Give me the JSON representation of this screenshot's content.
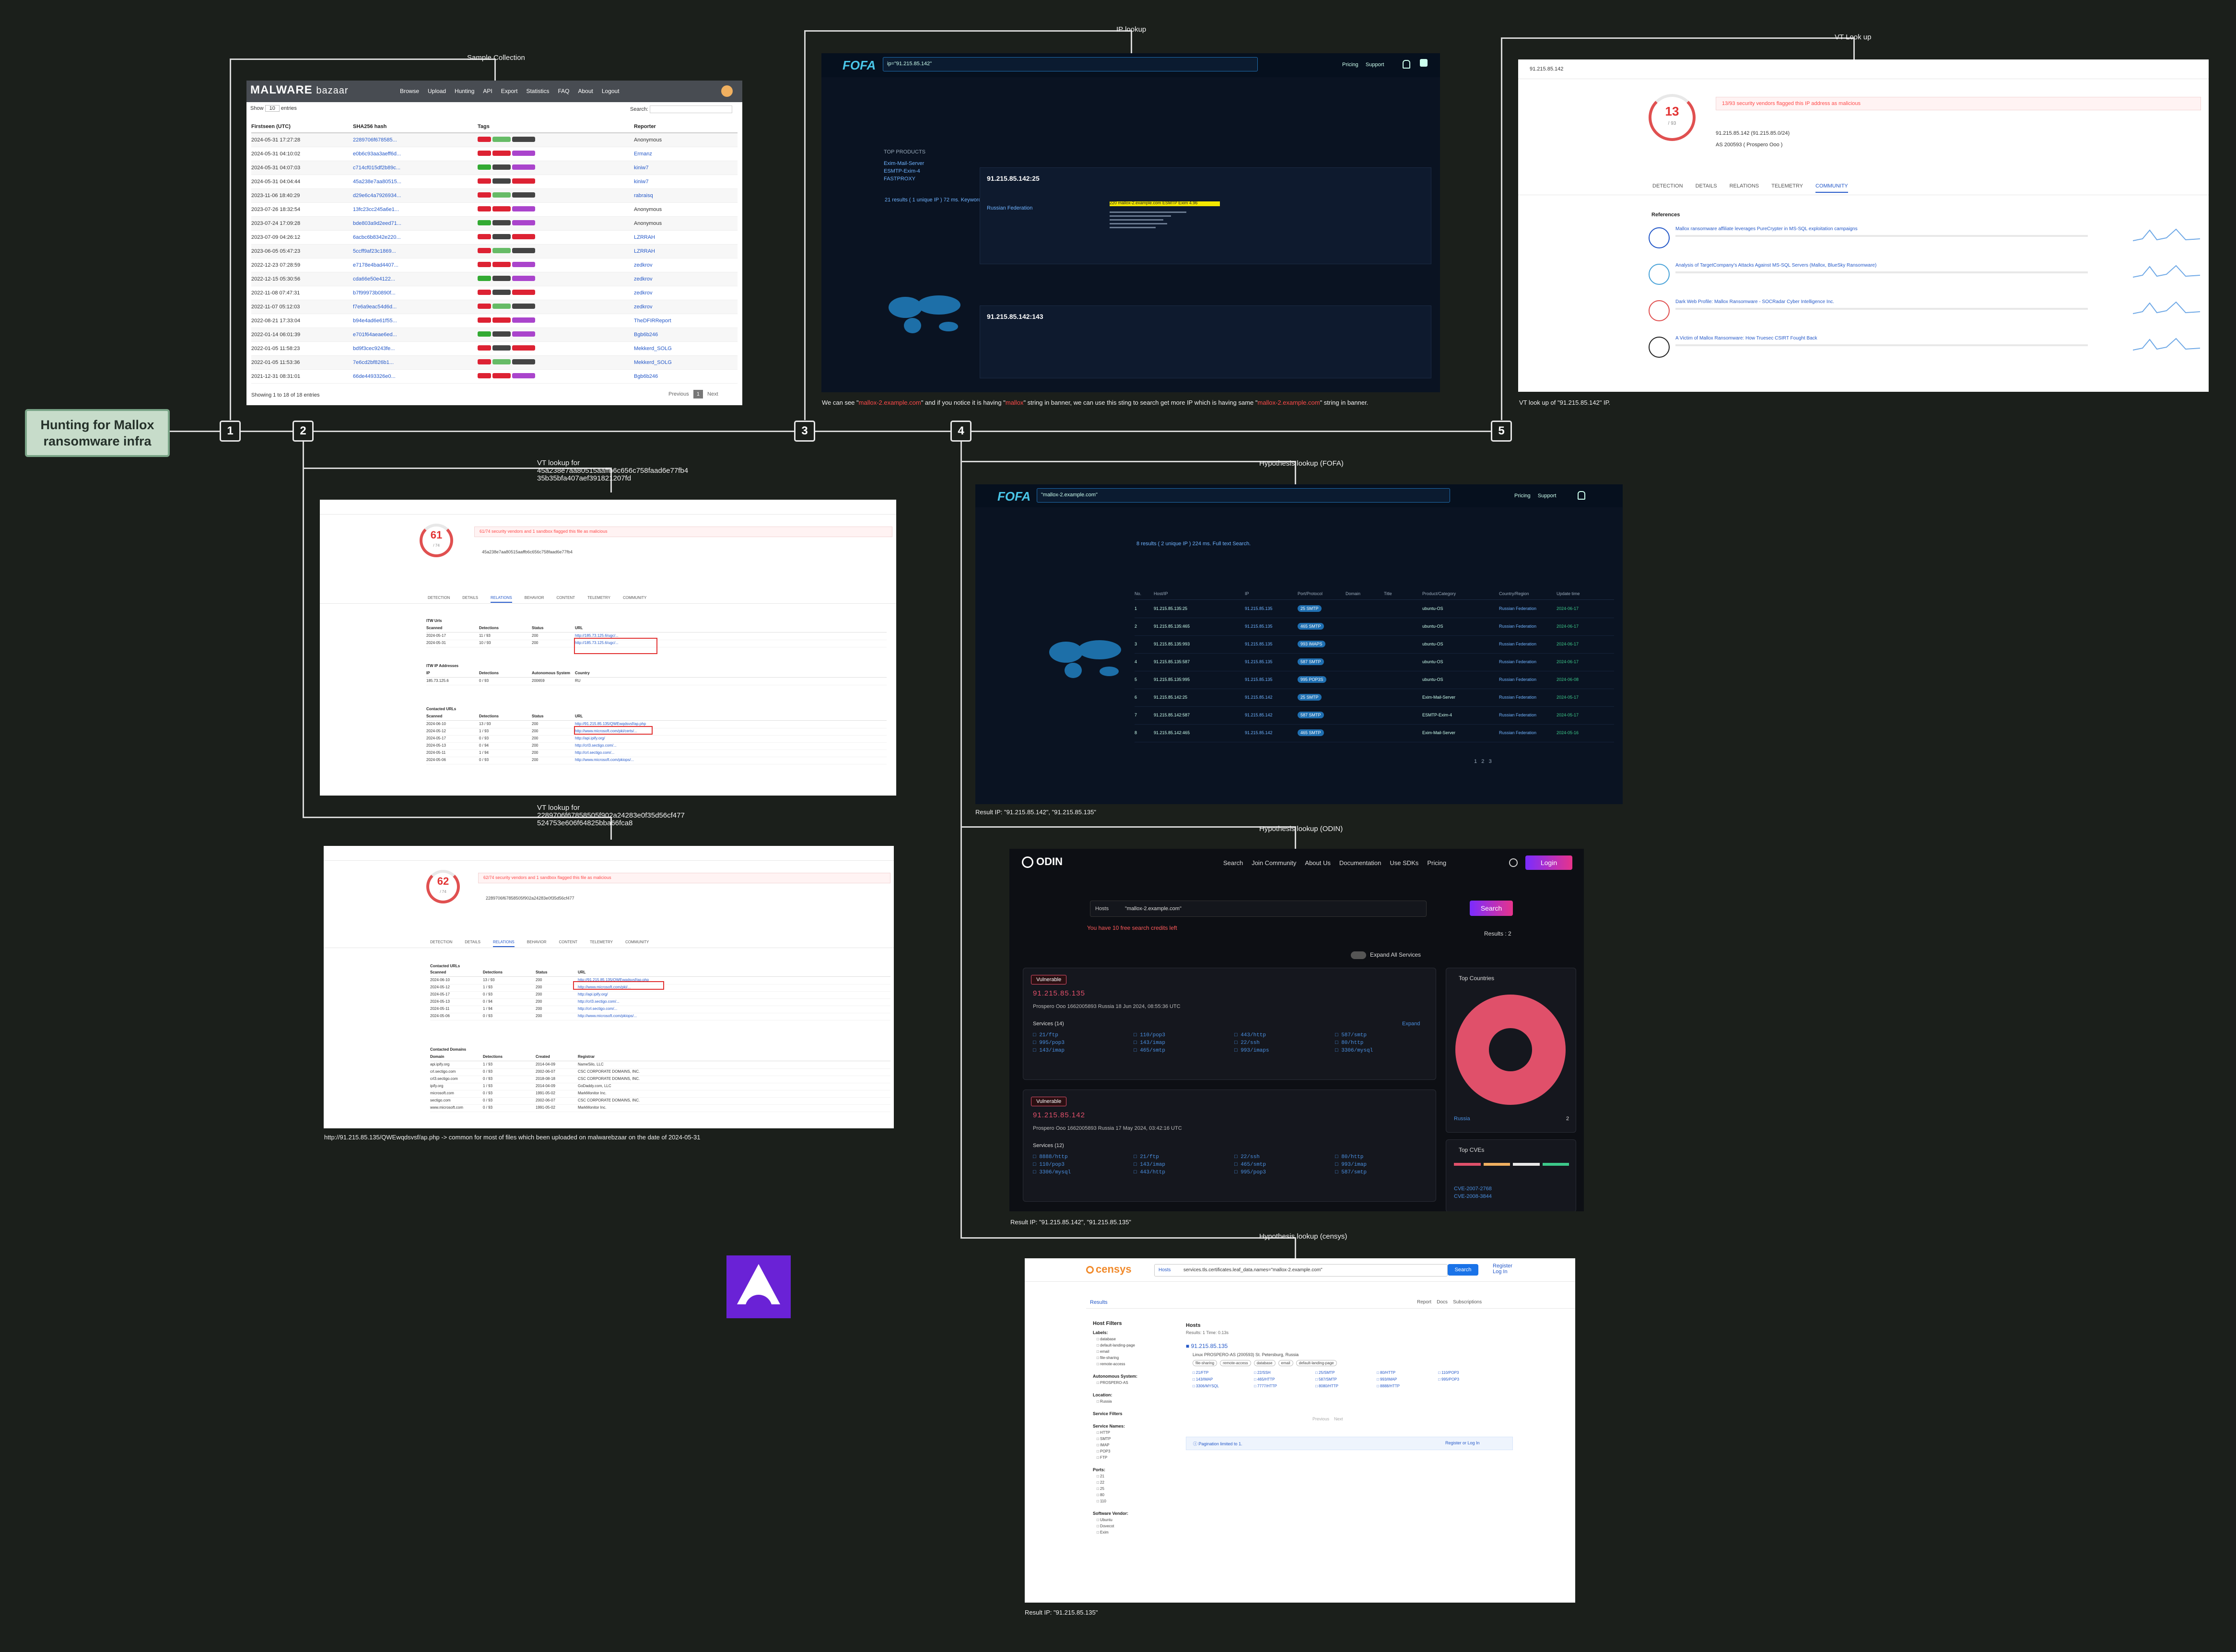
{
  "root": {
    "label": "Hunting for Mallox ransomware infra"
  },
  "steps": [
    "1",
    "2",
    "3",
    "4",
    "5"
  ],
  "captions": {
    "sample_collection": "Sample Collection",
    "ip_lookup": "IP lookup",
    "vt_lookup": "VT Look up",
    "vt_lookup_1_line1": "VT lookup for",
    "vt_lookup_1_line2": "45a238e7aa80515aaffb6c656c758faad6e77fb4",
    "vt_lookup_1_line3": "35b35bfa407aef391821207fd",
    "vt_lookup_2_line1": "VT lookup for",
    "vt_lookup_2_line2": "2289706f67858505f902a24283e0f35d56cf477",
    "vt_lookup_2_line3": "524753e606f64825bba66fca8",
    "hyp_fofa": "Hypothesis lookup (FOFA)",
    "hyp_odin": "Hypothesis lookup (ODIN)",
    "hyp_censys": "Hypothesis lookup (censys)",
    "fofa_note_a": "We can see \"",
    "fofa_note_b": "mallox-2.example.com",
    "fofa_note_c": "\" and if you notice it is having \"",
    "fofa_note_d": "mallox",
    "fofa_note_e": "\" string in banner, we can use this sting to search get more IP which is having same \"",
    "fofa_note_f": "mallox-2.example.com",
    "fofa_note_g": "\" string in banner.",
    "vt_ip_result": "VT look up of \"91.215.85.142\" IP.",
    "url_note": "http://91.215.85.135/QWEwqdsvsf/ap.php -> common for most of files which been uploaded on malwarebzaar on the date of 2024-05-31",
    "fofa_result": "Result IP: \"91.215.85.142\", \"91.215.85.135\"",
    "odin_result": "Result IP: \"91.215.85.142\", \"91.215.85.135\"",
    "censys_result": "Result IP: \"91.215.85.135\""
  },
  "bazaar": {
    "logo_a": "MALWARE",
    "logo_b": "bazaar",
    "nav": [
      "Browse",
      "Upload",
      "Hunting",
      "API",
      "Export",
      "Statistics",
      "FAQ",
      "About",
      "Logout"
    ],
    "show_label": "Show",
    "entries_label": "entries",
    "search_label": "Search:",
    "headers": [
      "Firstseen (UTC)",
      "SHA256 hash",
      "Tags",
      "Reporter"
    ],
    "rows": [
      [
        "2024-05-31 17:27:28",
        "2289706f678585",
        "Anonymous"
      ],
      [
        "2024-05-31 04:10:02",
        "e0b6c93aa3aeff6d",
        "Ermanz"
      ],
      [
        "2024-05-31 04:07:03",
        "c714cf015df2b89c",
        "kiniw7"
      ],
      [
        "2024-05-31 04:04:44",
        "45a238e7aa80515",
        "kiniw7"
      ],
      [
        "2023-11-06 18:40:29",
        "d29e6c4a7926934",
        "rabraisq"
      ],
      [
        "2023-07-26 18:32:54",
        "13fc23cc245a6e1",
        "Anonymous"
      ],
      [
        "2023-07-24 17:09:28",
        "bde803a9d2eed71",
        "Anonymous"
      ],
      [
        "2023-07-09 04:26:12",
        "6acbc6b8342e220",
        "LZRRAH"
      ],
      [
        "2023-06-05 05:47:23",
        "5ccff9af23c1869",
        "LZRRAH"
      ],
      [
        "2022-12-23 07:28:59",
        "e7178e4bad4407",
        "zedkrov"
      ],
      [
        "2022-12-15 05:30:56",
        "cda66e50e4122",
        "zedkrov"
      ],
      [
        "2022-11-08 07:47:31",
        "b7f99973b0890f",
        "zedkrov"
      ],
      [
        "2022-11-07 05:12:03",
        "f7e6a9eac54d6d",
        "zedkrov"
      ],
      [
        "2022-08-21 17:33:04",
        "b94e4ad6e61f55",
        "TheDFIRReport"
      ],
      [
        "2022-01-14 06:01:39",
        "e701f64aeae6ed",
        "Bgb6b246"
      ],
      [
        "2022-01-05 11:58:23",
        "bd9f3cec9243fe",
        "Mekkerd_SOLG"
      ],
      [
        "2022-01-05 11:53:36",
        "7e6cd2bf826b1",
        "Mekkerd_SOLG"
      ],
      [
        "2021-12-31 08:31:01",
        "66de4493326e0",
        "Bgb6b246"
      ]
    ],
    "footer": "Showing 1 to 18 of 18 entries",
    "prev": "Previous",
    "page": "1",
    "next": "Next"
  },
  "fofa1": {
    "logo": "FOFA",
    "query": "ip=\"91.215.85.142\"",
    "links": [
      "Pricing",
      "Support"
    ],
    "summary": "21 results ( 1 unique IP ) 72 ms. Keyword Search.",
    "side_title": "TOP PRODUCTS",
    "side_items": [
      "Exim-Mail-Server",
      "ESMTP-Exim-4",
      "FASTPROXY"
    ],
    "result1_ip": "91.215.85.142:25",
    "result1_country": "Russian Federation",
    "result1_banner": "220 mallox-2.example.com ESMTP Exim 4.96",
    "result2_ip": "91.215.85.142:143"
  },
  "vt5": {
    "query": "91.215.85.142",
    "score": "13",
    "score_total": "/ 93",
    "flag_text": "13/93 security vendors flagged this IP address as malicious",
    "ip_line": "91.215.85.142 (91.215.85.0/24)",
    "as_line": "AS 200593 ( Prospero Ooo )",
    "tabs": [
      "DETECTION",
      "DETAILS",
      "RELATIONS",
      "TELEMETRY",
      "COMMUNITY"
    ],
    "refs_title": "References",
    "refs": [
      "Mallox ransomware affiliate leverages PureCrypter in MS-SQL exploitation campaigns",
      "Analysis of TargetCompany's Attacks Against MS-SQL Servers (Mallox, BlueSky Ransomware)",
      "Dark Web Profile: Mallox Ransomware - SOCRadar Cyber Intelligence Inc.",
      "A Victim of Mallox Ransomware: How Truesec CSIRT Fought Back"
    ]
  },
  "vt2": {
    "score": "61",
    "score_total": "/ 74",
    "flag_text": "61/74 security vendors and 1 sandbox flagged this file as malicious",
    "hash": "45a238e7aa80515aaffb6c656c758faad6e77fb4",
    "tabs": [
      "DETECTION",
      "DETAILS",
      "RELATIONS",
      "BEHAVIOR",
      "CONTENT",
      "TELEMETRY",
      "COMMUNITY"
    ],
    "section1": "ITW Urls",
    "section2": "ITW IP Addresses",
    "section3": "Contacted URLs",
    "headers": [
      "Scanned",
      "Detections",
      "Status",
      "URL"
    ],
    "itw": [
      [
        "2024-05-17",
        "11 / 93",
        "200",
        "http://185.73.125.6/ugc/..."
      ],
      [
        "2024-05-31",
        "10 / 93",
        "200",
        "http://185.73.125.6/ugc/..."
      ]
    ],
    "ip_row": [
      "185.73.125.6",
      "0 / 93",
      "200659",
      "RU"
    ],
    "contacted": [
      [
        "2024-06-10",
        "13 / 93",
        "200",
        "http://91.215.85.135/QWEwqdsvsf/ap.php"
      ],
      [
        "2024-05-12",
        "1 / 93",
        "200",
        "http://www.microsoft.com/pki/certs/..."
      ],
      [
        "2024-05-17",
        "0 / 93",
        "200",
        "http://api.ipify.org/"
      ],
      [
        "2024-05-13",
        "0 / 94",
        "200",
        "http://crl3.sectigo.com/..."
      ],
      [
        "2024-05-11",
        "1 / 94",
        "200",
        "http://crl.sectigo.com/..."
      ],
      [
        "2024-05-06",
        "0 / 93",
        "200",
        "http://www.microsoft.com/pkiops/..."
      ]
    ]
  },
  "vt3": {
    "score": "62",
    "score_total": "/ 74",
    "flag_text": "62/74 security vendors and 1 sandbox flagged this file as malicious",
    "hash": "2289706f67858505f902a24283e0f35d56cf477",
    "tabs": [
      "DETECTION",
      "DETAILS",
      "RELATIONS",
      "BEHAVIOR",
      "CONTENT",
      "TELEMETRY",
      "COMMUNITY"
    ],
    "section1": "Contacted URLs",
    "section2": "Contacted Domains",
    "headers": [
      "Scanned",
      "Detections",
      "Status",
      "URL"
    ],
    "contacted": [
      [
        "2024-06-10",
        "13 / 93",
        "200",
        "http://91.215.85.135/QWEwqdsvsf/ap.php"
      ],
      [
        "2024-05-12",
        "1 / 93",
        "200",
        "http://www.microsoft.com/pki/..."
      ],
      [
        "2024-05-17",
        "0 / 93",
        "200",
        "http://api.ipify.org/"
      ],
      [
        "2024-05-13",
        "0 / 94",
        "200",
        "http://crl3.sectigo.com/..."
      ],
      [
        "2024-05-11",
        "1 / 94",
        "200",
        "http://crl.sectigo.com/..."
      ],
      [
        "2024-05-06",
        "0 / 93",
        "200",
        "http://www.microsoft.com/pkiops/..."
      ]
    ],
    "dom_headers": [
      "Domain",
      "Detections",
      "Created",
      "Registrar"
    ],
    "domains": [
      [
        "api.ipify.org",
        "1 / 93",
        "2014-04-09",
        "NameSilo, LLC"
      ],
      [
        "crl.sectigo.com",
        "0 / 93",
        "2002-06-07",
        "CSC CORPORATE DOMAINS, INC."
      ],
      [
        "crl3.sectigo.com",
        "0 / 93",
        "2018-08-18",
        "CSC CORPORATE DOMAINS, INC."
      ],
      [
        "ipify.org",
        "1 / 93",
        "2014-04-09",
        "GoDaddy.com, LLC"
      ],
      [
        "microsoft.com",
        "0 / 93",
        "1991-05-02",
        "MarkMonitor Inc."
      ],
      [
        "sectigo.com",
        "0 / 93",
        "2002-06-07",
        "CSC CORPORATE DOMAINS, INC."
      ],
      [
        "www.microsoft.com",
        "0 / 93",
        "1991-05-02",
        "MarkMonitor Inc."
      ]
    ]
  },
  "fofa4": {
    "logo": "FOFA",
    "query": "\"mallox-2.example.com\"",
    "links": [
      "Pricing",
      "Support"
    ],
    "summary": "8 results ( 2 unique IP ) 224 ms. Full text Search.",
    "headers": [
      "No.",
      "Host/IP",
      "IP",
      "Port/Protocol",
      "Domain",
      "Title",
      "Product/Category",
      "Country/Region",
      "Update time"
    ],
    "rows": [
      [
        "1",
        "91.215.85.135:25",
        "91.215.85.135",
        "25",
        "SMTP",
        "ubuntu-OS",
        "Russian Federation",
        "2024-06-17"
      ],
      [
        "2",
        "91.215.85.135:465",
        "91.215.85.135",
        "465",
        "SMTP",
        "ubuntu-OS",
        "Russian Federation",
        "2024-06-17"
      ],
      [
        "3",
        "91.215.85.135:993",
        "91.215.85.135",
        "993",
        "IMAPS",
        "ubuntu-OS",
        "Russian Federation",
        "2024-06-17"
      ],
      [
        "4",
        "91.215.85.135:587",
        "91.215.85.135",
        "587",
        "SMTP",
        "ubuntu-OS",
        "Russian Federation",
        "2024-06-17"
      ],
      [
        "5",
        "91.215.85.135:995",
        "91.215.85.135",
        "995",
        "POP3S",
        "ubuntu-OS",
        "Russian Federation",
        "2024-06-08"
      ],
      [
        "6",
        "91.215.85.142:25",
        "91.215.85.142",
        "25",
        "SMTP",
        "Exim-Mail-Server",
        "Russian Federation",
        "2024-05-17"
      ],
      [
        "7",
        "91.215.85.142:587",
        "91.215.85.142",
        "587",
        "SMTP",
        "ESMTP-Exim-4",
        "Russian Federation",
        "2024-05-17"
      ],
      [
        "8",
        "91.215.85.142:465",
        "91.215.85.142",
        "465",
        "SMTP",
        "Exim-Mail-Server",
        "Russian Federation",
        "2024-05-16"
      ]
    ]
  },
  "odin": {
    "logo": "ODIN",
    "nav": [
      "Search",
      "Join Community",
      "About Us",
      "Documentation",
      "Use SDKs",
      "Pricing"
    ],
    "login": "Login",
    "scope": "Hosts",
    "query": "\"mallox-2.example.com\"",
    "search_btn": "Search",
    "credits": "You have 10 free search credits left",
    "results": "Results : 2",
    "expand": "Expand All Services",
    "card1": {
      "badge": "Vulnerable",
      "ip": "91.215.85.135",
      "org": "Prospero Ooo",
      "asn": "1662005893",
      "country": "Russia",
      "date": "18 Jun 2024, 08:55:36 UTC",
      "services_label": "Services (14)",
      "expand": "Expand",
      "services": [
        "21/ftp",
        "110/pop3",
        "443/http",
        "587/smtp",
        "995/pop3",
        "143/imap",
        "22/ssh",
        "80/http",
        "143/imap",
        "465/smtp",
        "993/imaps",
        "3306/mysql"
      ]
    },
    "card2": {
      "badge": "Vulnerable",
      "ip": "91.215.85.142",
      "org": "Prospero Ooo",
      "asn": "1662005893",
      "country": "Russia",
      "date": "17 May 2024, 03:42:16 UTC",
      "services_label": "Services (12)",
      "services": [
        "8888/http",
        "21/ftp",
        "22/ssh",
        "80/http",
        "110/pop3",
        "143/imap",
        "465/smtp",
        "993/imap",
        "3306/mysql",
        "443/http",
        "995/pop3",
        "587/smtp"
      ]
    },
    "top_countries": "Top Countries",
    "country_name": "Russia",
    "country_count": "2",
    "top_cves": "Top CVEs",
    "cves": [
      "CVE-2007-2768",
      "CVE-2008-3844"
    ]
  },
  "censys": {
    "logo": "censys",
    "scope": "Hosts",
    "query": "services.tls.certificates.leaf_data.names=\"mallox-2.example.com\"",
    "search_btn": "Search",
    "register": "Register",
    "login": "Log In",
    "results_tab": "Results",
    "actions": [
      "Report",
      "Docs",
      "Subscriptions"
    ],
    "filters_title": "Host Filters",
    "filter_groups": [
      {
        "name": "Labels:",
        "items": [
          "database",
          "default-landing-page",
          "email",
          "file-sharing",
          "remote-access"
        ]
      },
      {
        "name": "Autonomous System:",
        "items": [
          "PROSPERO-AS"
        ]
      },
      {
        "name": "Location:",
        "items": [
          "Russia"
        ]
      },
      {
        "name": "Service Filters",
        "items": []
      },
      {
        "name": "Service Names:",
        "items": [
          "HTTP",
          "SMTP",
          "IMAP",
          "POP3",
          "FTP"
        ]
      },
      {
        "name": "Ports:",
        "items": [
          "21",
          "22",
          "25",
          "80",
          "110"
        ]
      },
      {
        "name": "Software Vendor:",
        "items": [
          "Ubuntu",
          "Dovecot",
          "Exim"
        ]
      }
    ],
    "hosts_title": "Hosts",
    "hosts_sub": "Results: 1   Time: 0.13s",
    "host_ip": "91.215.85.135",
    "host_meta": "Linux   PROSPERO-AS (200593)   St. Petersburg, Russia",
    "labels": [
      "file-sharing",
      "remote-access",
      "database",
      "email",
      "default-landing-page"
    ],
    "services": [
      "21/FTP",
      "22/SSH",
      "25/SMTP",
      "80/HTTP",
      "110/POP3",
      "143/IMAP",
      "465/HTTP",
      "587/SMTP",
      "993/IMAP",
      "995/POP3",
      "3306/MYSQL",
      "7777/HTTP",
      "8080/HTTP",
      "8888/HTTP"
    ],
    "pagination": "Pagination limited to 1.",
    "register_prompt": "Register or Log In",
    "prev": "Previous",
    "next": "Next"
  }
}
